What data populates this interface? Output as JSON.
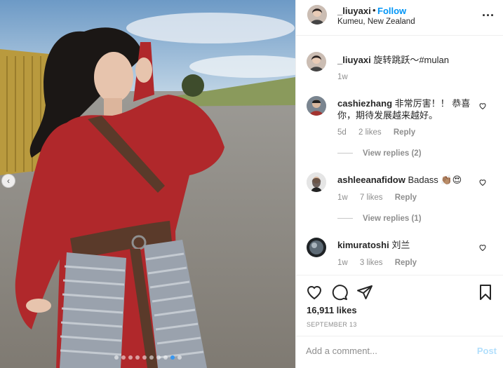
{
  "post": {
    "username": "_liuyaxi",
    "follow_label": "Follow",
    "separator": "•",
    "location": "Kumeu, New Zealand",
    "more_label": "···"
  },
  "caption": {
    "username": "_liuyaxi",
    "text": "旋转跳跃～#mulan",
    "time": "1w"
  },
  "comments": [
    {
      "username": "cashiezhang",
      "text": "非常厉害！！ 恭喜你，期待发展越来越好。",
      "time": "5d",
      "likes": "2 likes",
      "reply": "Reply",
      "view_replies": "View replies (2)"
    },
    {
      "username": "ashleeanafidow",
      "text": "Badass 👏🏽😍",
      "time": "1w",
      "likes": "7 likes",
      "reply": "Reply",
      "view_replies": "View replies (1)"
    },
    {
      "username": "kimuratoshi",
      "text": "刘兰",
      "time": "1w",
      "likes": "3 likes",
      "reply": "Reply"
    }
  ],
  "stats": {
    "likes": "16,911 likes",
    "date": "SEPTEMBER 13"
  },
  "add_comment": {
    "placeholder": "Add a comment...",
    "post_label": "Post"
  },
  "photo": {
    "prev_label": "‹",
    "dot_count": 10,
    "active_dot": 8
  },
  "colors": {
    "link_blue": "#0095f6",
    "post_disabled": "#b2dffc",
    "muted": "#8e8e8e",
    "robe_red": "#b0282b"
  },
  "icons": [
    "more-icon",
    "heart-icon",
    "comment-icon",
    "share-icon",
    "save-icon",
    "chevron-left-icon"
  ]
}
